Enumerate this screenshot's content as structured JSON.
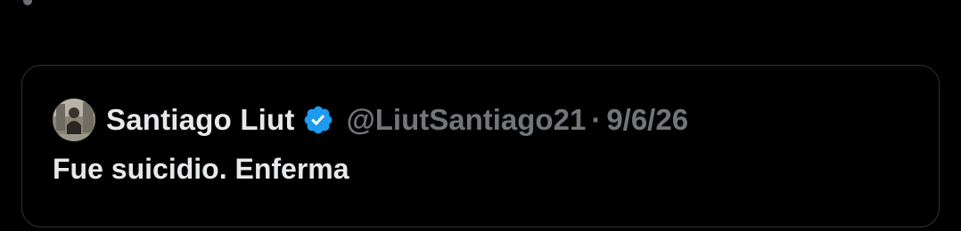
{
  "quoted_tweet": {
    "author": {
      "display_name": "Santiago Liut",
      "handle": "@LiutSantiago21",
      "verified": true,
      "verified_icon": "verified-badge-icon",
      "avatar": "avatar-photo"
    },
    "separator": "·",
    "date": "9/6/26",
    "text": "Fue suicidio. Enferma"
  },
  "colors": {
    "background": "#000000",
    "card_border": "#2f3336",
    "primary_text": "#e7e9ea",
    "secondary_text": "#71767b",
    "verified_blue": "#1d9bf0"
  }
}
